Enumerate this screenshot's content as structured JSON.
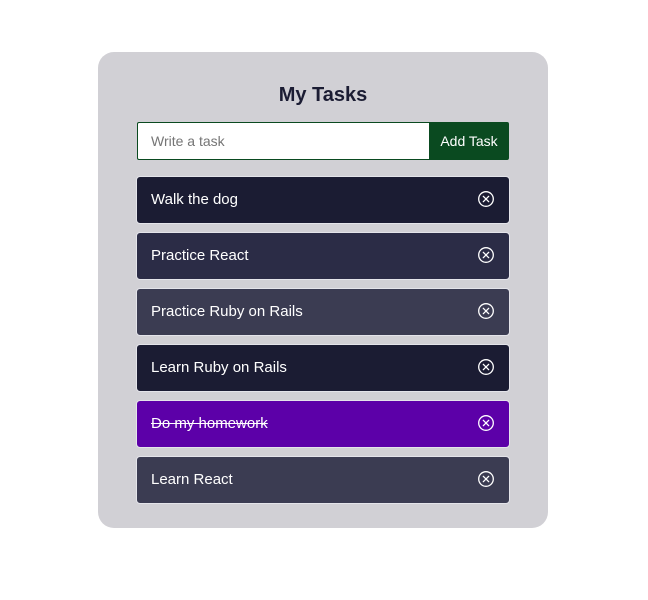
{
  "app": {
    "title": "My Tasks"
  },
  "form": {
    "placeholder": "Write a task",
    "value": "",
    "add_label": "Add Task"
  },
  "tasks": [
    {
      "label": "Walk the dog",
      "completed": false,
      "color": "#1b1c33"
    },
    {
      "label": "Practice React",
      "completed": false,
      "color": "#2b2c46"
    },
    {
      "label": "Practice Ruby on Rails",
      "completed": false,
      "color": "#3b3c52"
    },
    {
      "label": "Learn Ruby on Rails",
      "completed": false,
      "color": "#1b1c33"
    },
    {
      "label": "Do my homework",
      "completed": true,
      "color": "#5c00a8"
    },
    {
      "label": "Learn React",
      "completed": false,
      "color": "#3b3c52"
    }
  ],
  "icons": {
    "delete": "circle-x-icon"
  },
  "colors": {
    "panel": "#d1d0d5",
    "accent": "#0a4a20",
    "title": "#1b1c33"
  }
}
